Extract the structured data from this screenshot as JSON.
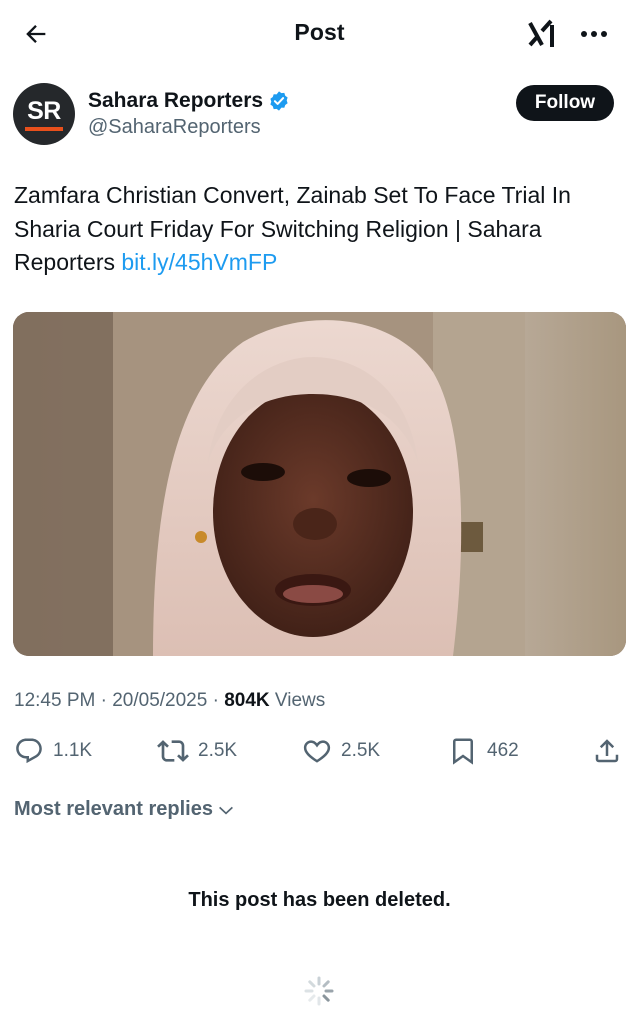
{
  "header": {
    "title": "Post",
    "back_icon": "arrow-left-icon",
    "grok_icon": "grok-icon",
    "more_icon": "more-horizontal-icon"
  },
  "author": {
    "avatar_text": "SR",
    "avatar_bg": "#25282b",
    "avatar_accent": "#e8501c",
    "name": "Sahara Reporters",
    "handle": "@SaharaReporters",
    "verified": true,
    "verified_color": "#1d9bf0"
  },
  "follow_label": "Follow",
  "post": {
    "text": "Zamfara Christian Convert, Zainab Set To Face Trial In Sharia Court Friday For Switching Religion | Sahara Reporters ",
    "link": "bit.ly/45hVmFP",
    "link_color": "#1d9bf0"
  },
  "meta": {
    "time": "12:45 PM",
    "date": "20/05/2025",
    "views": "804K",
    "views_label": "Views"
  },
  "actions": {
    "replies": "1.1K",
    "reposts": "2.5K",
    "likes": "2.5K",
    "bookmarks": "462"
  },
  "replies_section": {
    "sort_label": "Most relevant replies",
    "deleted_message": "This post has been deleted."
  }
}
